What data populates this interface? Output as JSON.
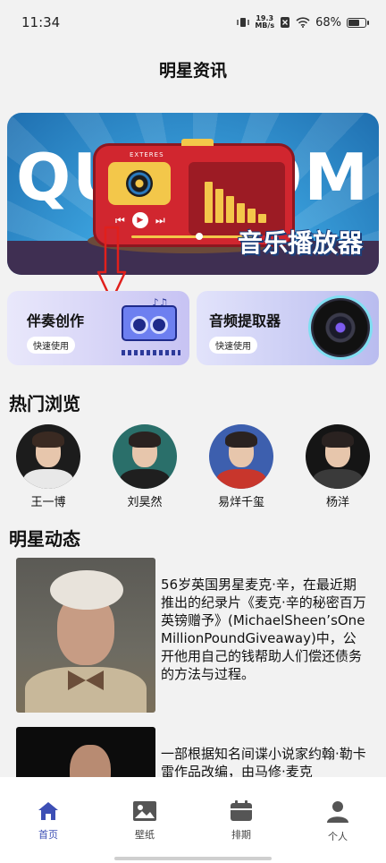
{
  "status": {
    "time": "11:34",
    "net_speed_value": "19.3",
    "net_speed_unit": "MB/s",
    "battery": "68%"
  },
  "title": "明星资讯",
  "banner": {
    "letters_left": "QU",
    "letters_right": "OM",
    "radio_brand": "EXTERES",
    "caption": "音乐播放器"
  },
  "features": [
    {
      "title": "伴奏创作",
      "button": "快速使用"
    },
    {
      "title": "音频提取器",
      "button": "快速使用"
    }
  ],
  "hot": {
    "heading": "热门浏览",
    "stars": [
      {
        "name": "王一博"
      },
      {
        "name": "刘昊然"
      },
      {
        "name": "易烊千玺"
      },
      {
        "name": "杨洋"
      }
    ]
  },
  "news": {
    "heading": "明星动态",
    "items": [
      {
        "text": "56岁英国男星麦克·辛，在最近期推出的纪录片《麦克·辛的秘密百万英镑赠予》(MichaelSheen’sOneMillionPoundGiveaway)中，公开他用自己的钱帮助人们偿还债务的方法与过程。"
      },
      {
        "text": "一部根据知名间谍小说家约翰·勒卡雷作品改编，由马修·麦克"
      }
    ]
  },
  "nav": [
    {
      "label": "首页",
      "icon": "home-icon",
      "active": true
    },
    {
      "label": "壁纸",
      "icon": "image-icon",
      "active": false
    },
    {
      "label": "排期",
      "icon": "calendar-icon",
      "active": false
    },
    {
      "label": "个人",
      "icon": "person-icon",
      "active": false
    }
  ],
  "colors": {
    "accent": "#3d4fb5",
    "background": "#f2f2f2",
    "annotation_arrow": "#e0201c"
  }
}
